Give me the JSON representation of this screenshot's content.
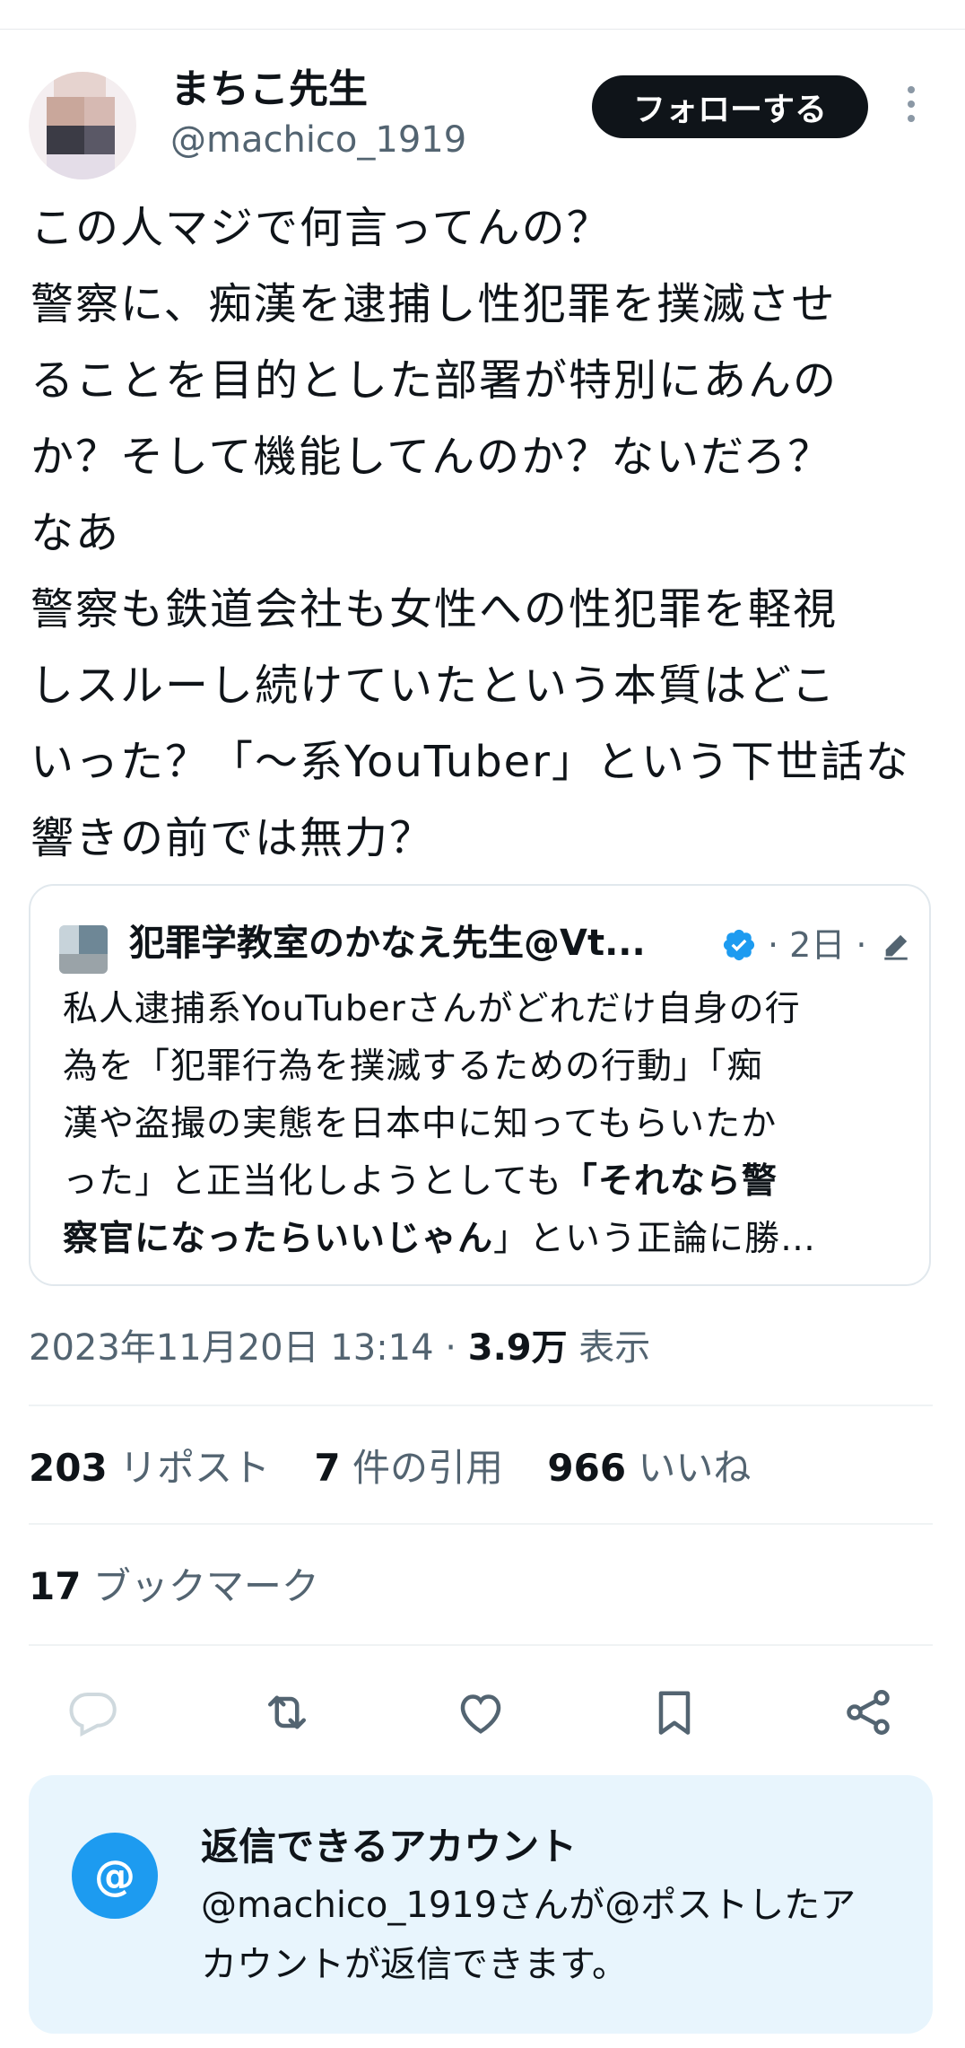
{
  "author": {
    "display_name": "まちこ先生",
    "handle": "@machico_1919"
  },
  "follow_button": {
    "label": "フォローする"
  },
  "tweet": {
    "text": "この人マジで何言ってんの？\n警察に、痴漢を逮捕し性犯罪を撲滅させ\nることを目的とした部署が特別にあんの\nか？そして機能してんのか？ないだろ？\nなあ\n警察も鉄道会社も女性への性犯罪を軽視\nしスルーし続けていたという本質はどこ\nいった？「〜系YouTuber」という下世話な\n響きの前では無力？"
  },
  "quote": {
    "author_name": "犯罪学教室のかなえ先生@Vt...",
    "meta": "· 2日 ·",
    "text_plain": "私人逮捕系YouTuberさんがどれだけ自身の行\n為を「犯罪行為を撲滅するための行動」「痴\n漢や盗撮の実態を日本中に知ってもらいたか\nった」と正当化しようとしても",
    "text_bold": "「それなら警\n察官になったらいいじゃん",
    "text_tail": "」という正論に勝…"
  },
  "timestamp": {
    "date": "2023年11月20日 13:14 · ",
    "views": "3.9万",
    "views_label": " 表示"
  },
  "stats": {
    "reposts": {
      "count": "203",
      "label": "リポスト"
    },
    "quotes": {
      "count": "7",
      "label": "件の引用"
    },
    "likes": {
      "count": "966",
      "label": "いいね"
    },
    "bookmarks": {
      "count": "17",
      "label": "ブックマーク"
    }
  },
  "actions": [
    "reply-icon",
    "repost-icon",
    "like-icon",
    "bookmark-icon",
    "share-icon"
  ],
  "reply_restriction": {
    "icon": "@",
    "title": "返信できるアカウント",
    "description": "@machico_1919さんが@ポストしたア\nカウントが返信できます。"
  },
  "colors": {
    "text": "#0f1419",
    "secondary": "#536471",
    "accent": "#1d9bf0",
    "reply_box_bg": "#e8f5fd"
  }
}
